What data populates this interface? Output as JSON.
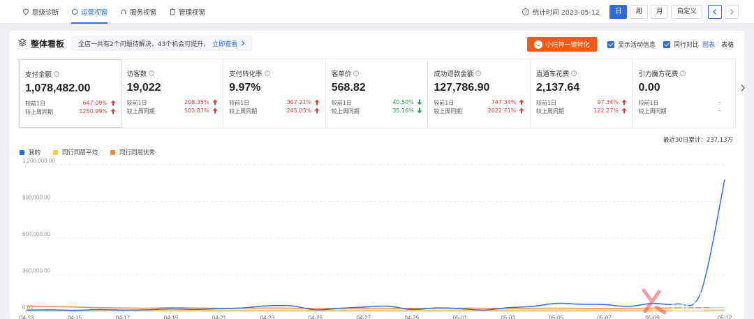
{
  "nav": {
    "items": [
      {
        "label": "层级诊断",
        "active": false
      },
      {
        "label": "运营视窗",
        "active": true
      },
      {
        "label": "服务视窗",
        "active": false
      },
      {
        "label": "管理视窗",
        "active": false
      }
    ],
    "stat_time": "统计时间 2023-05-12",
    "periods": [
      "日",
      "周",
      "月",
      "自定义"
    ],
    "active_period": "日"
  },
  "board": {
    "title": "整体看板",
    "issue_text": "全店一共有2个问题待解决，43个机会可提升，",
    "issue_link": "立即查看",
    "promo_label": "小旺神一键转化",
    "show_activity_label": "显示活动信息",
    "peer_compare_label": "同行对比",
    "view_chart": "图表",
    "view_table": "表格"
  },
  "metrics": [
    {
      "label": "支付金额",
      "value": "1,078,482.00",
      "rows": [
        {
          "label": "较前1日",
          "pct": "647.09%",
          "dir": "up"
        },
        {
          "label": "较上周同期",
          "pct": "1250.99%",
          "dir": "up"
        }
      ]
    },
    {
      "label": "访客数",
      "value": "19,022",
      "rows": [
        {
          "label": "较前1日",
          "pct": "208.35%",
          "dir": "up"
        },
        {
          "label": "较上周同期",
          "pct": "503.87%",
          "dir": "up"
        }
      ]
    },
    {
      "label": "支付转化率",
      "value": "9.97%",
      "rows": [
        {
          "label": "较前1日",
          "pct": "307.21%",
          "dir": "up"
        },
        {
          "label": "较上周同期",
          "pct": "245.03%",
          "dir": "up"
        }
      ]
    },
    {
      "label": "客单价",
      "value": "568.82",
      "rows": [
        {
          "label": "较前1日",
          "pct": "40.50%",
          "dir": "down"
        },
        {
          "label": "较上周同期",
          "pct": "35.16%",
          "dir": "down"
        }
      ]
    },
    {
      "label": "成功退款金额",
      "value": "127,786.90",
      "rows": [
        {
          "label": "较前1日",
          "pct": "747.34%",
          "dir": "up"
        },
        {
          "label": "较上周同期",
          "pct": "2022.71%",
          "dir": "up"
        }
      ]
    },
    {
      "label": "直通车花费",
      "value": "2,137.64",
      "rows": [
        {
          "label": "较前1日",
          "pct": "97.34%",
          "dir": "up"
        },
        {
          "label": "较上周同期",
          "pct": "122.27%",
          "dir": "up"
        }
      ]
    },
    {
      "label": "引力魔方花费",
      "value": "0.00",
      "rows": [
        {
          "label": "较前1日",
          "pct": "-",
          "dir": "none"
        },
        {
          "label": "较上周同期",
          "pct": "-",
          "dir": "none"
        }
      ]
    }
  ],
  "colors": {
    "accent": "#2f6bde",
    "up": "#e4393c",
    "down": "#1e9e4a",
    "promo": "#f05a14"
  },
  "chart_data": {
    "type": "line",
    "total_note": "最近30日累计：237.13万",
    "ylim": [
      0,
      1200000
    ],
    "y_ticks": [
      0,
      300000,
      600000,
      900000,
      1200000
    ],
    "y_tick_labels": [
      "0.00",
      "300,000.00",
      "600,000.00",
      "900,000.00",
      "1,200,000.00"
    ],
    "x": [
      "04-13",
      "04-14",
      "04-15",
      "04-16",
      "04-17",
      "04-18",
      "04-19",
      "04-20",
      "04-21",
      "04-22",
      "04-23",
      "04-24",
      "04-25",
      "04-26",
      "04-27",
      "04-28",
      "04-29",
      "04-30",
      "05-01",
      "05-02",
      "05-03",
      "05-04",
      "05-05",
      "05-06",
      "05-07",
      "05-08",
      "05-09",
      "05-10",
      "05-11",
      "05-12"
    ],
    "x_tick_labels": [
      "04-13",
      "04-15",
      "04-17",
      "04-19",
      "04-21",
      "04-23",
      "04-25",
      "04-27",
      "04-29",
      "05-01",
      "05-03",
      "05-05",
      "05-07",
      "05-09",
      "05-12"
    ],
    "grid": true,
    "legend_position": "top-left",
    "series": [
      {
        "name": "我的",
        "color": "#2f6bde",
        "values": [
          10000,
          12000,
          8000,
          14000,
          10000,
          12000,
          20000,
          15000,
          22000,
          28000,
          45000,
          45000,
          12000,
          25000,
          35000,
          42000,
          15000,
          28000,
          22000,
          10000,
          30000,
          40000,
          65000,
          58000,
          55000,
          40000,
          65000,
          60000,
          150000,
          1078482
        ]
      },
      {
        "name": "同行同层平均",
        "color": "#f2c94c",
        "values": [
          9000,
          9000,
          9000,
          9000,
          9000,
          9000,
          9000,
          9000,
          9000,
          9000,
          9000,
          9000,
          9000,
          9000,
          9000,
          9000,
          9000,
          9000,
          9000,
          9000,
          9000,
          9000,
          9000,
          9000,
          9000,
          9000,
          9000,
          9000,
          9000,
          9000
        ]
      },
      {
        "name": "同行同层优秀",
        "color": "#f08a4b",
        "values": [
          42000,
          40000,
          35000,
          30000,
          28000,
          26000,
          30000,
          28000,
          25000,
          26000,
          27000,
          26000,
          25000,
          24000,
          26000,
          25000,
          24000,
          25000,
          26000,
          25000,
          24000,
          25000,
          26000,
          25000,
          24000,
          25000,
          26000,
          28000,
          30000,
          32000
        ]
      }
    ]
  }
}
